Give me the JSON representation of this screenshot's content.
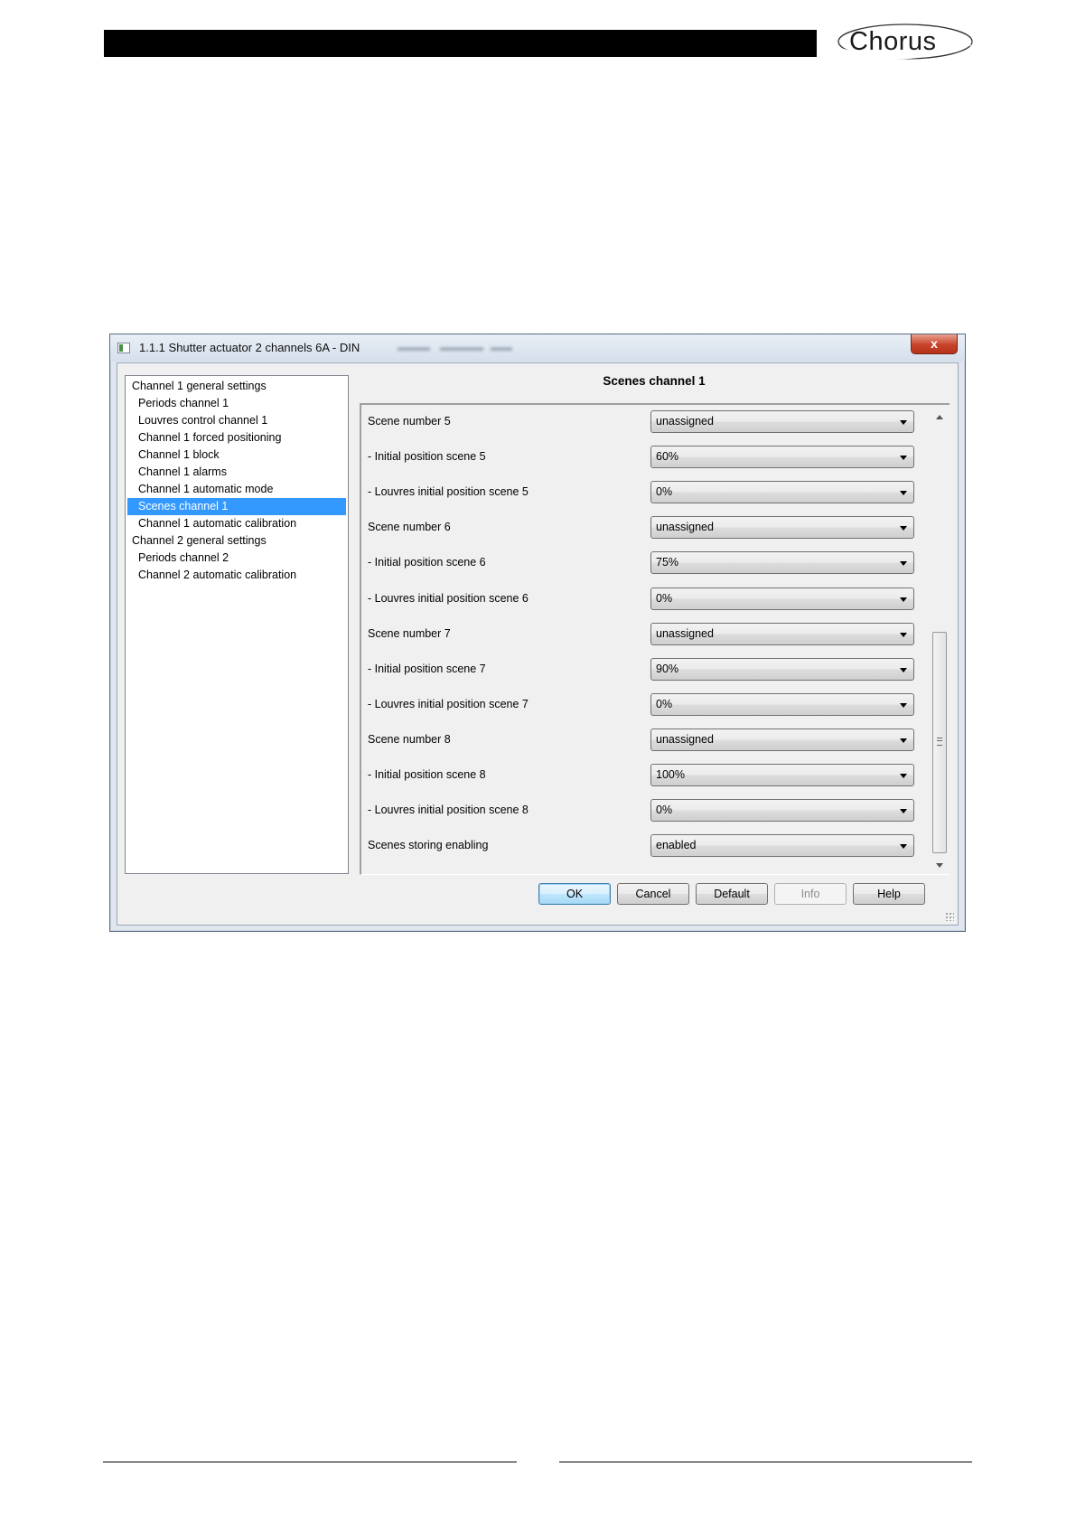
{
  "header": {
    "logo_text": "Chorus"
  },
  "window": {
    "title": "1.1.1 Shutter actuator 2 channels 6A - DIN",
    "close_glyph": "x"
  },
  "tree": {
    "items": [
      {
        "label": "Channel 1 general settings",
        "level": 0
      },
      {
        "label": "Periods channel 1",
        "level": 1
      },
      {
        "label": "Louvres control channel 1",
        "level": 1
      },
      {
        "label": "Channel 1 forced positioning",
        "level": 1
      },
      {
        "label": "Channel 1 block",
        "level": 1
      },
      {
        "label": "Channel 1 alarms",
        "level": 1
      },
      {
        "label": "Channel 1 automatic mode",
        "level": 1
      },
      {
        "label": "Scenes channel 1",
        "level": 1,
        "selected": true
      },
      {
        "label": "Channel 1 automatic calibration",
        "level": 1
      },
      {
        "label": "Channel 2 general settings",
        "level": 0
      },
      {
        "label": "Periods channel 2",
        "level": 1
      },
      {
        "label": "Channel 2 automatic calibration",
        "level": 1
      }
    ]
  },
  "panel": {
    "title": "Scenes channel 1",
    "params": [
      {
        "label": "Scene number 5",
        "value": "unassigned"
      },
      {
        "label": "- Initial position scene 5",
        "value": "60%"
      },
      {
        "label": "- Louvres initial position scene 5",
        "value": "0%"
      },
      {
        "label": "Scene number 6",
        "value": "unassigned"
      },
      {
        "label": "- Initial position scene 6",
        "value": "75%"
      },
      {
        "label": "- Louvres initial position scene 6",
        "value": "0%"
      },
      {
        "label": "Scene number 7",
        "value": "unassigned"
      },
      {
        "label": "- Initial position scene 7",
        "value": "90%"
      },
      {
        "label": "- Louvres initial position scene 7",
        "value": "0%"
      },
      {
        "label": "Scene number 8",
        "value": "unassigned"
      },
      {
        "label": "- Initial position scene 8",
        "value": "100%"
      },
      {
        "label": "- Louvres initial position scene 8",
        "value": "0%"
      },
      {
        "label": "Scenes storing enabling",
        "value": "enabled"
      }
    ]
  },
  "buttons": {
    "ok": "OK",
    "cancel": "Cancel",
    "default": "Default",
    "info": "Info",
    "help": "Help"
  },
  "colors": {
    "selection": "#3399ff",
    "close_button": "#c8432a",
    "header_bar": "#000000"
  }
}
